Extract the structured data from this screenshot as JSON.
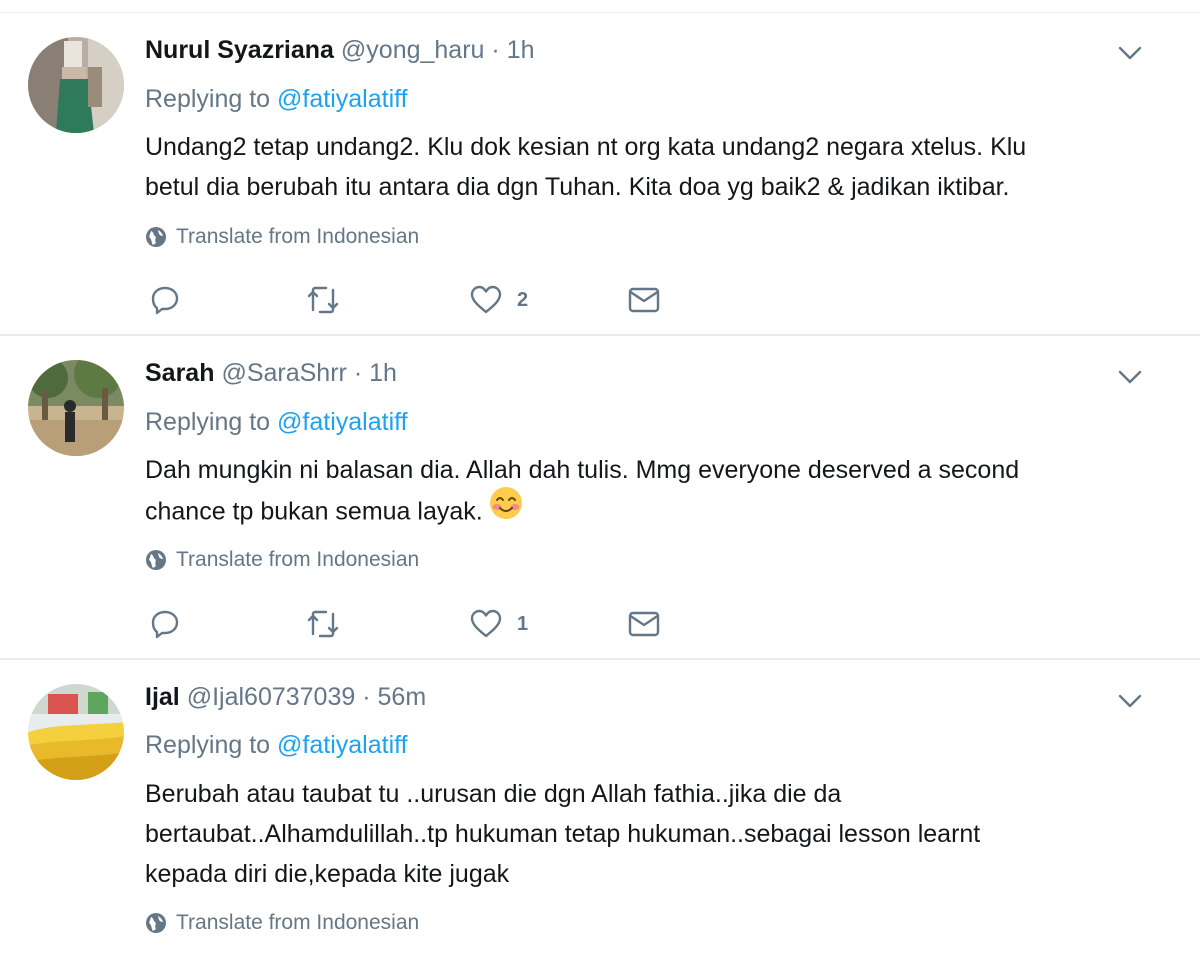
{
  "tweets": [
    {
      "name": "Nurul Syazriana",
      "handle": "@yong_haru",
      "dot": "·",
      "time": "1h",
      "replying_prefix": "Replying to",
      "replying_to": "@fatiyalatiff",
      "text_lines": [
        "Undang2 tetap undang2. Klu dok kesian nt org kata undang2 negara xtelus. Klu",
        "betul dia berubah itu antara dia dgn Tuhan. Kita doa yg baik2 & jadikan iktibar."
      ],
      "translate_label": "Translate from Indonesian",
      "like_count": "2",
      "avatar_icon": "avatar-woman-green-skirt"
    },
    {
      "name": "Sarah",
      "handle": "@SaraShrr",
      "dot": "·",
      "time": "1h",
      "replying_prefix": "Replying to",
      "replying_to": "@fatiyalatiff",
      "text_lines": [
        "Dah mungkin ni balasan dia. Allah dah tulis. Mmg everyone deserved a second",
        "chance tp bukan semua layak."
      ],
      "emoji": "smiling-face-emoji",
      "translate_label": "Translate from Indonesian",
      "like_count": "1",
      "avatar_icon": "avatar-person-under-trees"
    },
    {
      "name": "Ijal",
      "handle": "@Ijal60737039",
      "dot": "·",
      "time": "56m",
      "replying_prefix": "Replying to",
      "replying_to": "@fatiyalatiff",
      "text_lines": [
        "Berubah atau taubat tu ..urusan die dgn Allah fathia..jika die da",
        "bertaubat..Alhamdulillah..tp hukuman tetap hukuman..sebagai lesson learnt",
        "kepada diri die,kepada kite jugak"
      ],
      "translate_label": "Translate from Indonesian",
      "avatar_icon": "avatar-bananas"
    }
  ],
  "colors": {
    "text": "#14171a",
    "muted": "#657786",
    "link": "#1da1f2",
    "divider": "#e6ecf0"
  },
  "icons": [
    "reply-icon",
    "retweet-icon",
    "heart-icon",
    "direct-message-icon",
    "globe-icon",
    "chevron-down-icon"
  ]
}
